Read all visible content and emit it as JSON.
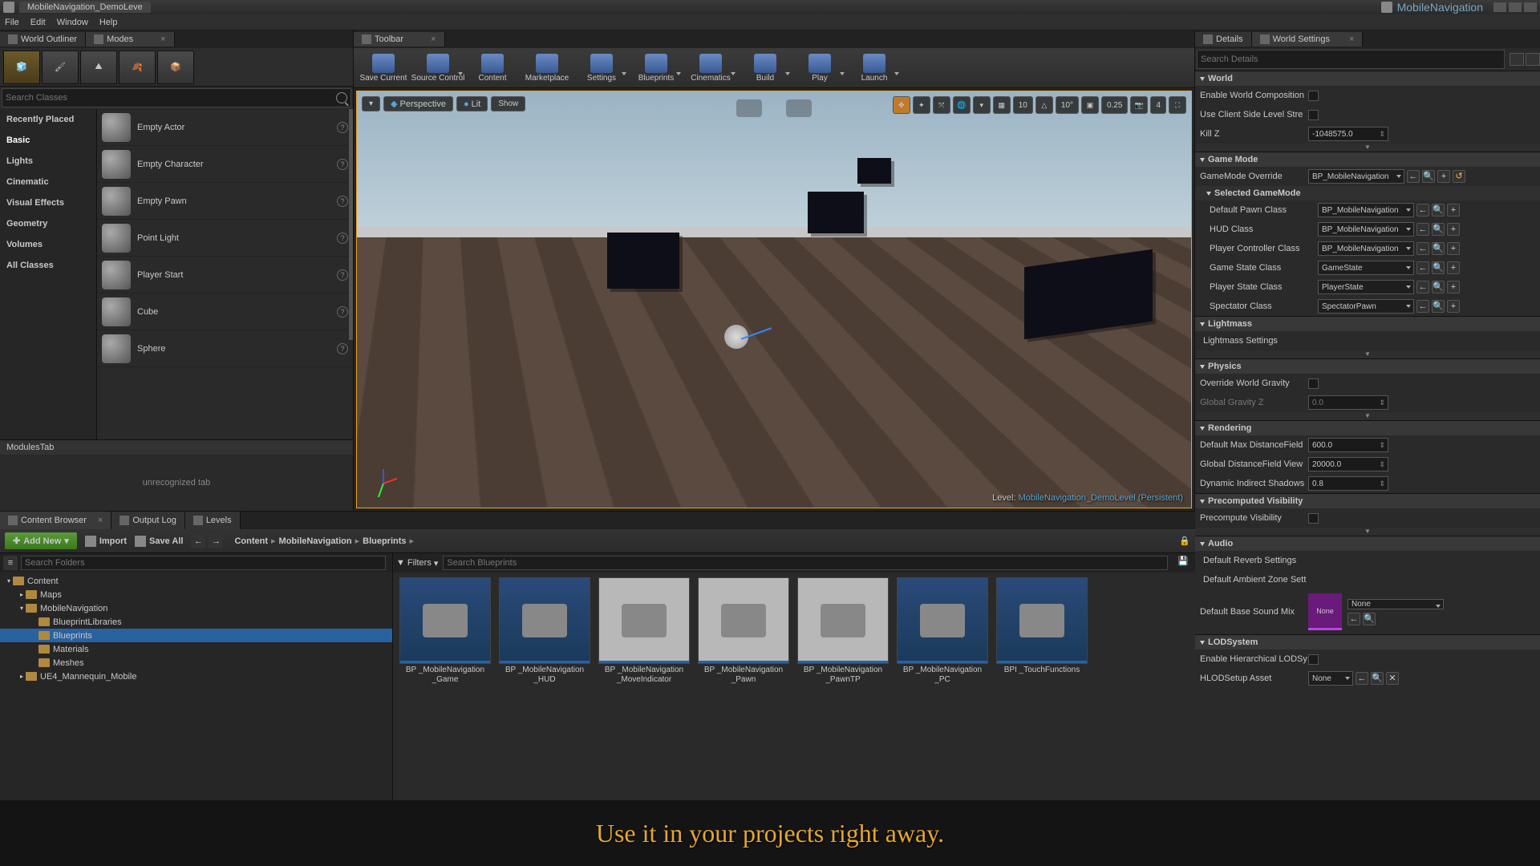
{
  "titlebar": {
    "level_tab": "MobileNavigation_DemoLeve",
    "project": "MobileNavigation"
  },
  "menu": [
    "File",
    "Edit",
    "Window",
    "Help"
  ],
  "left_tabs": {
    "outliner": "World Outliner",
    "modes": "Modes"
  },
  "modes_search_placeholder": "Search Classes",
  "modes_cats": [
    "Recently Placed",
    "Basic",
    "Lights",
    "Cinematic",
    "Visual Effects",
    "Geometry",
    "Volumes",
    "All Classes"
  ],
  "modes_cats_sel": 1,
  "modes_items": [
    "Empty Actor",
    "Empty Character",
    "Empty Pawn",
    "Point Light",
    "Player Start",
    "Cube",
    "Sphere"
  ],
  "modulestab": {
    "title": "ModulesTab",
    "body": "unrecognized tab"
  },
  "toolbar_tab": "Toolbar",
  "toolbar": [
    {
      "label": "Save Current",
      "dd": false
    },
    {
      "label": "Source Control",
      "dd": true
    },
    {
      "label": "Content",
      "dd": false
    },
    {
      "label": "Marketplace",
      "dd": false
    },
    {
      "label": "Settings",
      "dd": true
    },
    {
      "label": "Blueprints",
      "dd": true
    },
    {
      "label": "Cinematics",
      "dd": true
    },
    {
      "label": "Build",
      "dd": true
    },
    {
      "label": "Play",
      "dd": true
    },
    {
      "label": "Launch",
      "dd": true
    }
  ],
  "viewport": {
    "dropdown": "▾",
    "perspective": "Perspective",
    "lit": "Lit",
    "show": "Show",
    "snap_grid": "10",
    "snap_angle": "10°",
    "snap_scale": "0.25",
    "camspeed": "4",
    "level_prefix": "Level:  ",
    "level_name": "MobileNavigation_DemoLevel (Persistent)"
  },
  "right_tabs": {
    "details": "Details",
    "world": "World Settings"
  },
  "details_search_placeholder": "Search Details",
  "ws": {
    "world": {
      "h": "World",
      "ewc": "Enable World Composition",
      "ucsls": "Use Client Side Level Stre",
      "killz": "Kill Z",
      "killz_val": "-1048575.0"
    },
    "gamemode": {
      "h": "Game Mode",
      "ov": "GameMode Override",
      "ov_v": "BP_MobileNavigation",
      "sel": "Selected GameMode",
      "dpc": "Default Pawn Class",
      "dpc_v": "BP_MobileNavigation",
      "hud": "HUD Class",
      "hud_v": "BP_MobileNavigation",
      "pcc": "Player Controller Class",
      "pcc_v": "BP_MobileNavigation",
      "gsc": "Game State Class",
      "gsc_v": "GameState",
      "psc": "Player State Class",
      "psc_v": "PlayerState",
      "spc": "Spectator Class",
      "spc_v": "SpectatorPawn"
    },
    "lightmass": {
      "h": "Lightmass",
      "ls": "Lightmass Settings"
    },
    "physics": {
      "h": "Physics",
      "owg": "Override World Gravity",
      "ggz": "Global Gravity Z",
      "ggz_v": "0.0"
    },
    "rendering": {
      "h": "Rendering",
      "dmdf": "Default Max DistanceField",
      "dmdf_v": "600.0",
      "gdfv": "Global DistanceField View",
      "gdfv_v": "20000.0",
      "dis": "Dynamic Indirect Shadows",
      "dis_v": "0.8"
    },
    "precomp": {
      "h": "Precomputed Visibility",
      "pv": "Precompute Visibility"
    },
    "audio": {
      "h": "Audio",
      "drs": "Default Reverb Settings",
      "daz": "Default Ambient Zone Sett",
      "dbsm": "Default Base Sound Mix",
      "none": "None"
    },
    "lod": {
      "h": "LODSystem",
      "ehl": "Enable Hierarchical LODSy",
      "hsa": "HLODSetup Asset",
      "hsa_v": "None"
    }
  },
  "cb_tabs": {
    "cb": "Content Browser",
    "log": "Output Log",
    "lvls": "Levels"
  },
  "cb": {
    "addnew": "Add New",
    "import": "Import",
    "saveall": "Save All",
    "crumbs": [
      "Content",
      "MobileNavigation",
      "Blueprints"
    ],
    "folders_search_placeholder": "Search Folders",
    "assets_search_placeholder": "Search Blueprints",
    "filters": "Filters",
    "tree": [
      {
        "d": 0,
        "exp": "▾",
        "label": "Content"
      },
      {
        "d": 1,
        "exp": "▸",
        "label": "Maps"
      },
      {
        "d": 1,
        "exp": "▾",
        "label": "MobileNavigation"
      },
      {
        "d": 2,
        "exp": " ",
        "label": "BlueprintLibraries"
      },
      {
        "d": 2,
        "exp": " ",
        "label": "Blueprints",
        "sel": true
      },
      {
        "d": 2,
        "exp": " ",
        "label": "Materials"
      },
      {
        "d": 2,
        "exp": " ",
        "label": "Meshes"
      },
      {
        "d": 1,
        "exp": "▸",
        "label": "UE4_Mannequin_Mobile"
      }
    ],
    "assets": [
      {
        "label": "BP_MobileNavigation_Game"
      },
      {
        "label": "BP_MobileNavigation_HUD"
      },
      {
        "label": "BP_MobileNavigation_MoveIndicator",
        "light": true
      },
      {
        "label": "BP_MobileNavigation_Pawn",
        "light": true
      },
      {
        "label": "BP_MobileNavigation_PawnTP",
        "light": true
      },
      {
        "label": "BP_MobileNavigation_PC"
      },
      {
        "label": "BPI_TouchFunctions"
      }
    ]
  },
  "banner": "Use it in your projects right away."
}
